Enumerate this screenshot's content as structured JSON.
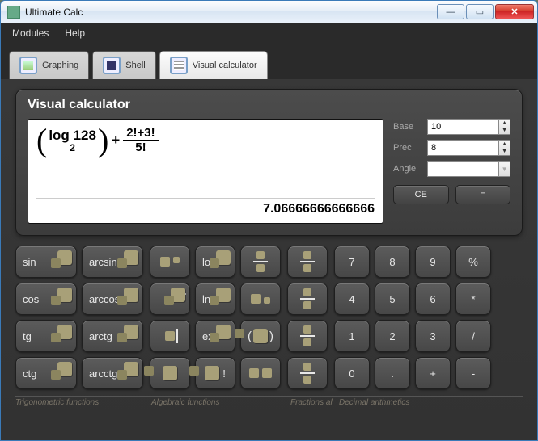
{
  "app": {
    "title": "Ultimate Calc"
  },
  "menu": {
    "modules": "Modules",
    "help": "Help"
  },
  "tabs": {
    "graphing": "Graphing",
    "shell": "Shell",
    "visual": "Visual calculator"
  },
  "panel": {
    "title": "Visual calculator",
    "expr": {
      "log_label": "log",
      "log_arg": "128",
      "log_base": "2",
      "plus": "+",
      "frac_num": "2!+3!",
      "frac_den": "5!"
    },
    "result": "7.06666666666666"
  },
  "settings": {
    "base_label": "Base",
    "base_value": "10",
    "prec_label": "Prec",
    "prec_value": "8",
    "angle_label": "Angle",
    "angle_value": "",
    "ce": "CE",
    "eq": "="
  },
  "keys": {
    "sin": "sin",
    "arcsin": "arcsin",
    "cos": "cos",
    "arccos": "arccos",
    "tg": "tg",
    "arctg": "arctg",
    "ctg": "ctg",
    "arcctg": "arcctg",
    "log": "log",
    "ln": "ln",
    "exp": "exp",
    "fact": "!",
    "n7": "7",
    "n8": "8",
    "n9": "9",
    "pct": "%",
    "n4": "4",
    "n5": "5",
    "n6": "6",
    "mul": "*",
    "n1": "1",
    "n2": "2",
    "n3": "3",
    "div": "/",
    "n0": "0",
    "dot": ".",
    "plus": "+",
    "minus": "-"
  },
  "footer": {
    "trig": "Trigonometric functions",
    "alg": "Algebraic functions",
    "frac": "Fractions al",
    "num": "Decimal arithmetics"
  }
}
